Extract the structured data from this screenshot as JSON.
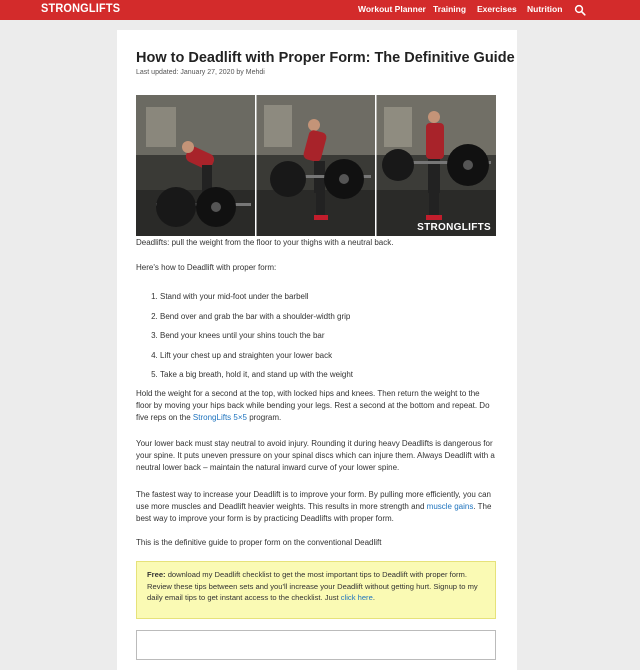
{
  "header": {
    "logo": "STRONGLIFTS",
    "nav": [
      "Workout Planner",
      "Training",
      "Exercises",
      "Nutrition"
    ],
    "search_icon": "search-icon",
    "brand_color": "#d32b2b"
  },
  "article": {
    "title": "How to Deadlift with Proper Form: The Definitive Guide",
    "meta": "Last updated: January 27, 2020 by Mehdi",
    "image_watermark": "STRONGLIFTS",
    "intro": "Deadlifts: pull the weight from the floor to your thighs with a neutral back.",
    "howto_lead": "Here's how to Deadlift with proper form:",
    "steps": [
      "Stand with your mid-foot under the barbell",
      "Bend over and grab the bar with a shoulder-width grip",
      "Bend your knees until your shins touch the bar",
      "Lift your chest up and straighten your lower back",
      "Take a big breath, hold it, and stand up with the weight"
    ],
    "para1_text": "Hold the weight for a second at the top, with locked hips and knees. Then return the weight to the floor by moving your hips back while bending your legs. Rest a second at the bottom and repeat. Do five reps on the ",
    "para1_link": "StrongLifts 5×5",
    "para1_tail": " program.",
    "para2": "Your lower back must stay neutral to avoid injury. Rounding it during heavy Deadlifts is dangerous for your spine. It puts uneven pressure on your spinal discs which can injure them. Always Deadlift with a neutral lower back – maintain the natural inward curve of your lower spine.",
    "para3_text": "The fastest way to increase your Deadlift is to improve your form. By pulling more efficiently, you can use more muscles and Deadlift heavier weights. This results in more strength and ",
    "para3_link": "muscle gains",
    "para3_tail": ". The best way to improve your form is by practicing Deadlifts with proper form.",
    "para4": "This is the definitive guide to proper form on the conventional Deadlift",
    "callout_bold": "Free:",
    "callout_text": " download my Deadlift checklist to get the most important tips to Deadlift with proper form. Review these tips between sets and you'll increase your Deadlift without getting hurt. Signup to my daily email tips to get instant access to the checklist. Just ",
    "callout_link": "click here",
    "callout_tail": "."
  }
}
